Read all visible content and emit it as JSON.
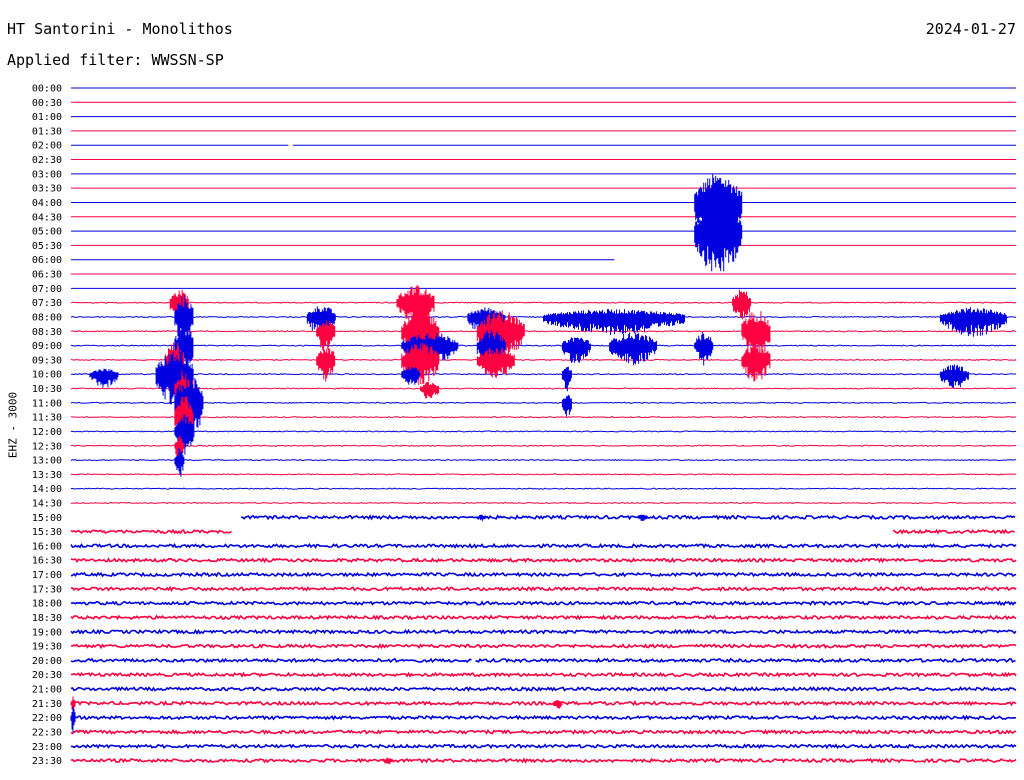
{
  "header": {
    "station": "HT Santorini - Monolithos",
    "date": "2024-01-27",
    "filter": "Applied filter: WWSSN-SP"
  },
  "chart_data": {
    "type": "line",
    "title": "HT Santorini - Monolithos",
    "ylabel": "EHZ - 3000",
    "row_labels": [
      "00:00",
      "00:30",
      "01:00",
      "01:30",
      "02:00",
      "02:30",
      "03:00",
      "03:30",
      "04:00",
      "04:30",
      "05:00",
      "05:30",
      "06:00",
      "06:30",
      "07:00",
      "07:30",
      "08:00",
      "08:30",
      "09:00",
      "09:30",
      "10:00",
      "10:30",
      "11:00",
      "11:30",
      "12:00",
      "12:30",
      "13:00",
      "13:30",
      "14:00",
      "14:30",
      "15:00",
      "15:30",
      "16:00",
      "16:30",
      "17:00",
      "17:30",
      "18:00",
      "18:30",
      "19:00",
      "19:30",
      "20:00",
      "20:30",
      "21:00",
      "21:30",
      "22:00",
      "22:30",
      "23:00",
      "23:30"
    ],
    "colors": {
      "blue": "#0000e0",
      "red": "#ff0040"
    },
    "row_minutes": 30,
    "rows": [
      {
        "time": "00:00",
        "noise": 0,
        "events": []
      },
      {
        "time": "00:30",
        "noise": 0,
        "events": []
      },
      {
        "time": "01:00",
        "noise": 0,
        "events": []
      },
      {
        "time": "01:30",
        "noise": 0,
        "events": []
      },
      {
        "time": "02:00",
        "noise": 0,
        "gaps": [
          [
            0.23,
            0.235
          ]
        ],
        "events": []
      },
      {
        "time": "02:30",
        "noise": 0,
        "events": []
      },
      {
        "time": "03:00",
        "noise": 0,
        "events": []
      },
      {
        "time": "03:30",
        "noise": 0,
        "events": []
      },
      {
        "time": "04:00",
        "noise": 0,
        "events": [
          [
            0.66,
            0.71,
            30,
            45
          ]
        ]
      },
      {
        "time": "04:30",
        "noise": 0,
        "events": []
      },
      {
        "time": "05:00",
        "noise": 0,
        "events": [
          [
            0.66,
            0.71,
            30,
            45
          ]
        ]
      },
      {
        "time": "05:30",
        "noise": 0,
        "events": []
      },
      {
        "time": "06:00",
        "noise": 0,
        "end": 0.575,
        "events": []
      },
      {
        "time": "06:30",
        "noise": 0,
        "events": []
      },
      {
        "time": "07:00",
        "noise": 0,
        "events": []
      },
      {
        "time": "07:30",
        "noise": 0.5,
        "events": [
          [
            0.105,
            0.125,
            14,
            20
          ],
          [
            0.345,
            0.385,
            18,
            24
          ],
          [
            0.7,
            0.72,
            14,
            20
          ]
        ]
      },
      {
        "time": "08:00",
        "noise": 0.5,
        "events": [
          [
            0.11,
            0.13,
            22,
            30
          ],
          [
            0.25,
            0.28,
            12,
            20
          ],
          [
            0.42,
            0.46,
            10,
            20
          ],
          [
            0.5,
            0.65,
            8,
            18
          ],
          [
            0.92,
            0.99,
            10,
            20
          ]
        ]
      },
      {
        "time": "08:30",
        "noise": 0.5,
        "events": [
          [
            0.26,
            0.28,
            14,
            22
          ],
          [
            0.35,
            0.39,
            22,
            30
          ],
          [
            0.43,
            0.48,
            22,
            30
          ],
          [
            0.71,
            0.74,
            22,
            30
          ]
        ]
      },
      {
        "time": "09:00",
        "noise": 0.5,
        "events": [
          [
            0.11,
            0.13,
            22,
            30
          ],
          [
            0.35,
            0.41,
            14,
            20
          ],
          [
            0.43,
            0.46,
            16,
            24
          ],
          [
            0.52,
            0.55,
            10,
            20
          ],
          [
            0.57,
            0.62,
            14,
            20
          ],
          [
            0.66,
            0.68,
            14,
            20
          ]
        ]
      },
      {
        "time": "09:30",
        "noise": 0.5,
        "events": [
          [
            0.1,
            0.12,
            18,
            28
          ],
          [
            0.26,
            0.28,
            16,
            22
          ],
          [
            0.35,
            0.39,
            18,
            26
          ],
          [
            0.43,
            0.47,
            14,
            20
          ],
          [
            0.71,
            0.74,
            18,
            24
          ]
        ]
      },
      {
        "time": "10:00",
        "noise": 0.5,
        "events": [
          [
            0.02,
            0.05,
            6,
            14
          ],
          [
            0.09,
            0.13,
            24,
            32
          ],
          [
            0.35,
            0.37,
            8,
            12
          ],
          [
            0.52,
            0.53,
            10,
            18
          ],
          [
            0.92,
            0.95,
            10,
            16
          ]
        ]
      },
      {
        "time": "10:30",
        "noise": 0.5,
        "events": [
          [
            0.11,
            0.13,
            20,
            28
          ],
          [
            0.37,
            0.39,
            8,
            12
          ]
        ]
      },
      {
        "time": "11:00",
        "noise": 0.5,
        "events": [
          [
            0.11,
            0.14,
            30,
            40
          ],
          [
            0.52,
            0.53,
            10,
            16
          ]
        ]
      },
      {
        "time": "11:30",
        "noise": 0.5,
        "events": [
          [
            0.11,
            0.13,
            22,
            30
          ]
        ]
      },
      {
        "time": "12:00",
        "noise": 0.5,
        "events": [
          [
            0.11,
            0.13,
            18,
            24
          ]
        ]
      },
      {
        "time": "12:30",
        "noise": 0.5,
        "events": [
          [
            0.11,
            0.12,
            10,
            16
          ]
        ]
      },
      {
        "time": "13:00",
        "noise": 0.5,
        "events": [
          [
            0.11,
            0.12,
            12,
            18
          ]
        ]
      },
      {
        "time": "13:30",
        "noise": 0.5,
        "events": []
      },
      {
        "time": "14:00",
        "noise": 0.5,
        "events": []
      },
      {
        "time": "14:30",
        "noise": 0.5,
        "events": []
      },
      {
        "time": "15:00",
        "noise": 1.5,
        "start": 0.18,
        "events": [
          [
            0.43,
            0.44,
            3,
            4
          ],
          [
            0.6,
            0.61,
            3,
            4
          ]
        ]
      },
      {
        "time": "15:30",
        "noise": 1.5,
        "end": 0.17,
        "start2": 0.87,
        "events": []
      },
      {
        "time": "16:00",
        "noise": 1.5,
        "events": []
      },
      {
        "time": "16:30",
        "noise": 1.5,
        "events": []
      },
      {
        "time": "17:00",
        "noise": 1.5,
        "events": []
      },
      {
        "time": "17:30",
        "noise": 1.5,
        "events": []
      },
      {
        "time": "18:00",
        "noise": 1.5,
        "events": []
      },
      {
        "time": "18:30",
        "noise": 1.5,
        "events": []
      },
      {
        "time": "19:00",
        "noise": 1.5,
        "events": []
      },
      {
        "time": "19:30",
        "noise": 1.5,
        "events": []
      },
      {
        "time": "20:00",
        "noise": 1.5,
        "gaps": [
          [
            0.425,
            0.428
          ]
        ],
        "events": []
      },
      {
        "time": "20:30",
        "noise": 1.5,
        "events": []
      },
      {
        "time": "21:00",
        "noise": 1.5,
        "events": []
      },
      {
        "time": "21:30",
        "noise": 1.5,
        "events": [
          [
            0.0,
            0.005,
            8,
            10
          ],
          [
            0.51,
            0.52,
            4,
            6
          ]
        ]
      },
      {
        "time": "22:00",
        "noise": 1.5,
        "events": [
          [
            0.0,
            0.005,
            12,
            16
          ]
        ]
      },
      {
        "time": "22:30",
        "noise": 1.5,
        "events": []
      },
      {
        "time": "23:00",
        "noise": 1.5,
        "events": []
      },
      {
        "time": "23:30",
        "noise": 1.5,
        "events": [
          [
            0.33,
            0.34,
            3,
            4
          ]
        ]
      }
    ]
  }
}
